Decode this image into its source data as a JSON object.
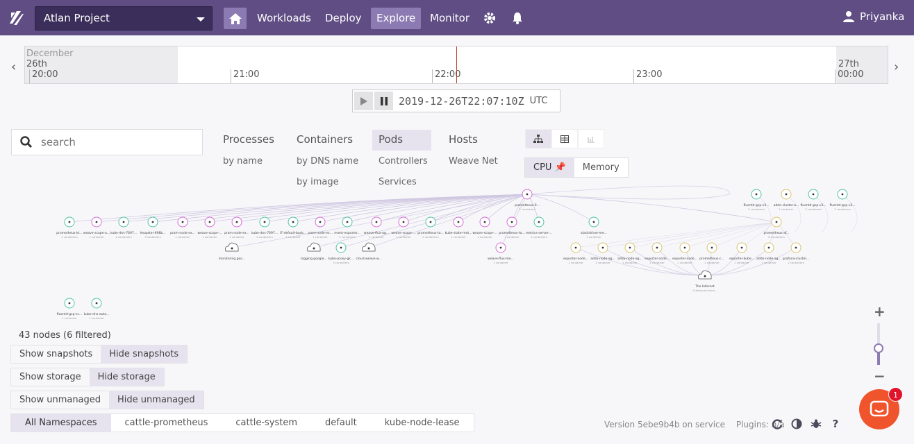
{
  "header": {
    "project": "Atlan Project",
    "nav": [
      "Workloads",
      "Deploy",
      "Explore",
      "Monitor"
    ],
    "active_nav": "Explore",
    "user": "Priyanka"
  },
  "timeline": {
    "start_month": "December",
    "start_day": "26th",
    "end_day": "27th",
    "ticks": [
      "20:00",
      "21:00",
      "22:00",
      "23:00",
      "00:00"
    ],
    "current_time": "2019-12-26T22:07:10Z",
    "tz": "UTC"
  },
  "search": {
    "placeholder": "search"
  },
  "topologies": {
    "processes": "Processes",
    "processes_by_name": "by name",
    "containers": "Containers",
    "containers_by_dns": "by DNS name",
    "containers_by_image": "by image",
    "pods": "Pods",
    "controllers": "Controllers",
    "services": "Services",
    "hosts": "Hosts",
    "weave_net": "Weave Net"
  },
  "metrics": {
    "cpu": "CPU",
    "memory": "Memory"
  },
  "node_count": "43 nodes (6 filtered)",
  "toggles": {
    "show_snapshots": "Show snapshots",
    "hide_snapshots": "Hide snapshots",
    "show_storage": "Show storage",
    "hide_storage": "Hide storage",
    "show_unmanaged": "Show unmanaged",
    "hide_unmanaged": "Hide unmanaged"
  },
  "namespaces": [
    "All Namespaces",
    "cattle-prometheus",
    "cattle-system",
    "default",
    "kube-node-lease"
  ],
  "footer": {
    "version": "Version 5ebe9b4b on service",
    "plugins": "Plugins: n/a"
  },
  "chat_badge": "1",
  "colors": {
    "topbar": "#5f4d84",
    "accent": "#8b7bb2",
    "teal": "#4fc3a1",
    "pink": "#d66bd4",
    "yellow": "#d9c26b"
  },
  "graph": {
    "hub": "prometheus-0...",
    "hub_sub": "2 containers",
    "internet": "The Internet",
    "internet_sub": "Outbound conne...",
    "nodes": [
      {
        "label": "prometheus-kt...",
        "sub": "2 containers",
        "color": "teal"
      },
      {
        "label": "weave-scope-a...",
        "sub": "1 container",
        "color": "pink"
      },
      {
        "label": "kube-dns-7697...",
        "sub": "4 containers",
        "color": "teal"
      },
      {
        "label": "heapster-698b...",
        "sub": "3 containers",
        "color": "teal"
      },
      {
        "label": "prom-node-ex...",
        "sub": "1 container",
        "color": "pink"
      },
      {
        "label": "weave-scope-...",
        "sub": "1 container",
        "color": "pink"
      },
      {
        "label": "prom-node-ex...",
        "sub": "1 container",
        "color": "pink"
      },
      {
        "label": "kube-dns-7697...",
        "sub": "4 containers",
        "color": "teal"
      },
      {
        "label": "l7-default-back...",
        "sub": "1 container",
        "color": "teal"
      },
      {
        "label": "prom-node-ex...",
        "sub": "1 container",
        "color": "pink"
      },
      {
        "label": "event-exporter...",
        "sub": "2 containers",
        "color": "teal"
      },
      {
        "label": "weave-flux-ag...",
        "sub": "1 container",
        "color": "pink"
      },
      {
        "label": "weave-scope-...",
        "sub": "1 container",
        "color": "pink"
      },
      {
        "label": "prometheus-to...",
        "sub": "2 containers",
        "color": "teal"
      },
      {
        "label": "kube-state-met...",
        "sub": "1 container",
        "color": "pink"
      },
      {
        "label": "weave-scope-...",
        "sub": "1 container",
        "color": "pink"
      },
      {
        "label": "prometheus-to...",
        "sub": "1 container",
        "color": "pink"
      },
      {
        "label": "metrics-server-...",
        "sub": "2 containers",
        "color": "teal"
      },
      {
        "label": "stackdriver-me...",
        "sub": "1 container",
        "color": "teal"
      },
      {
        "label": "prometheus-af...",
        "sub": "6 containers",
        "color": "yellow"
      },
      {
        "label": "monitoring.goo...",
        "sub": "",
        "color": "cloud"
      },
      {
        "label": "logging.google...",
        "sub": "",
        "color": "cloud"
      },
      {
        "label": "kube-proxy-gk...",
        "sub": "3 containers",
        "color": "teal"
      },
      {
        "label": "cloud.weave.w...",
        "sub": "",
        "color": "cloud"
      },
      {
        "label": "weave-flux-me...",
        "sub": "1 container",
        "color": "pink"
      },
      {
        "label": "exporter-node...",
        "sub": "1 container",
        "color": "yellow"
      },
      {
        "label": "addo-node-ag...",
        "sub": "1 container",
        "color": "yellow"
      },
      {
        "label": "addo-node-ag...",
        "sub": "1 container",
        "color": "yellow"
      },
      {
        "label": "exporter-node...",
        "sub": "1 container",
        "color": "yellow"
      },
      {
        "label": "exporter-node...",
        "sub": "1 container",
        "color": "yellow"
      },
      {
        "label": "prometheus-c...",
        "sub": "1 container",
        "color": "yellow"
      },
      {
        "label": "exporter-kube...",
        "sub": "1 container",
        "color": "yellow"
      },
      {
        "label": "addo-node-ag...",
        "sub": "1 container",
        "color": "yellow"
      },
      {
        "label": "grafana-cluster...",
        "sub": "2 containers",
        "color": "yellow"
      },
      {
        "label": "fluentd-gcp-v3...",
        "sub": "2 containers",
        "color": "teal"
      },
      {
        "label": "addo-cluster-a...",
        "sub": "1 container",
        "color": "yellow"
      },
      {
        "label": "fluentd-gcp-v3...",
        "sub": "2 containers",
        "color": "teal"
      },
      {
        "label": "fluentd-gcp-v3...",
        "sub": "2 containers",
        "color": "teal"
      },
      {
        "label": "fluentd-gcp-sc...",
        "sub": "1 container",
        "color": "teal"
      },
      {
        "label": "kube-dns-auto...",
        "sub": "1 container",
        "color": "teal"
      }
    ]
  }
}
